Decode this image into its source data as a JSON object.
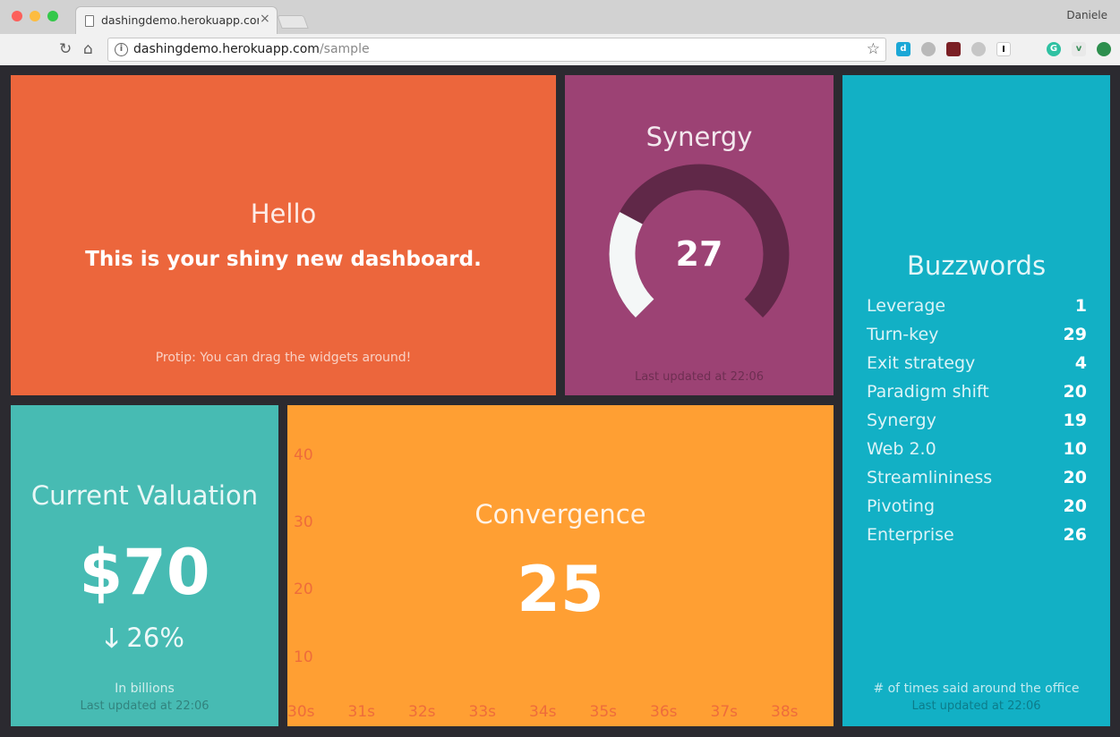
{
  "browser": {
    "tab_title": "dashingdemo.herokuapp.com/sample",
    "tab_close": "×",
    "profile_name": "Daniele",
    "url_host": "dashingdemo.herokuapp.com",
    "url_path": "/sample",
    "icons": [
      "reload-icon",
      "home-icon",
      "info-icon",
      "star-icon"
    ]
  },
  "hello": {
    "title": "Hello",
    "text": "This is your shiny new dashboard.",
    "moreinfo": "Protip: You can drag the widgets around!",
    "color": "#ec663c"
  },
  "synergy": {
    "title": "Synergy",
    "value": "27",
    "updated": "Last updated at 22:06",
    "meter_fraction": 0.27,
    "color": "#9c4274"
  },
  "buzzwords": {
    "title": "Buzzwords",
    "items": [
      {
        "label": "Leverage",
        "value": "1"
      },
      {
        "label": "Turn-key",
        "value": "29"
      },
      {
        "label": "Exit strategy",
        "value": "4"
      },
      {
        "label": "Paradigm shift",
        "value": "20"
      },
      {
        "label": "Synergy",
        "value": "19"
      },
      {
        "label": "Web 2.0",
        "value": "10"
      },
      {
        "label": "Streamlininess",
        "value": "20"
      },
      {
        "label": "Pivoting",
        "value": "20"
      },
      {
        "label": "Enterprise",
        "value": "26"
      }
    ],
    "moreinfo": "# of times said around the office",
    "updated": "Last updated at 22:06",
    "color": "#12b0c5"
  },
  "valuation": {
    "title": "Current Valuation",
    "value": "$70",
    "change_arrow": "arrow-down-icon",
    "change": "26%",
    "moreinfo": "In billions",
    "updated": "Last updated at 22:06",
    "color": "#47bbb3"
  },
  "convergence": {
    "title": "Convergence",
    "value": "25",
    "color": "#ff9f33"
  },
  "chart_data": {
    "type": "area",
    "x": [
      "30s",
      "31s",
      "32s",
      "33s",
      "34s",
      "35s",
      "36s",
      "37s",
      "38s"
    ],
    "yticks": [
      "40",
      "30",
      "20",
      "10"
    ]
  }
}
